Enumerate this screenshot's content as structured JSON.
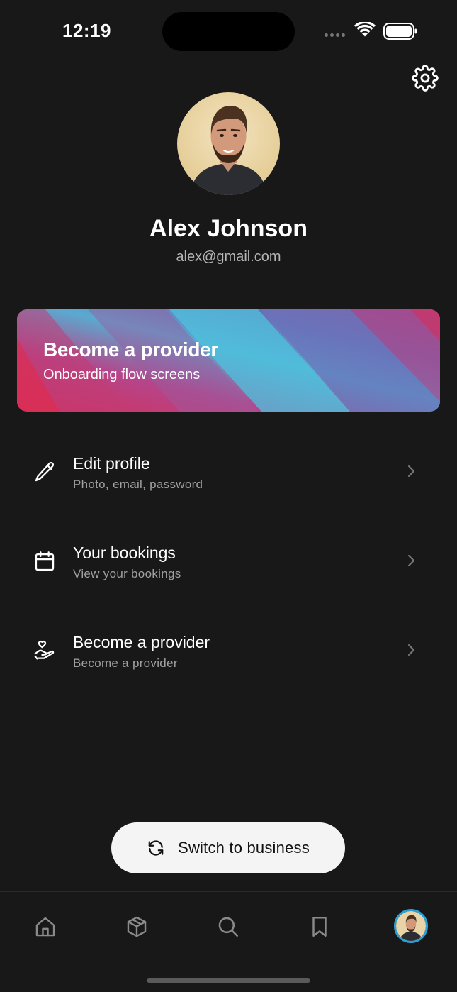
{
  "status_bar": {
    "time": "12:19"
  },
  "profile": {
    "name": "Alex Johnson",
    "email": "alex@gmail.com"
  },
  "banner": {
    "title": "Become a provider",
    "subtitle": "Onboarding flow screens",
    "colors": [
      "#d42f5a",
      "#b5458a",
      "#4fb8d6",
      "#6b6fb6",
      "#a04a8e"
    ]
  },
  "menu": [
    {
      "title": "Edit profile",
      "subtitle": "Photo, email, password",
      "icon": "pencil-icon"
    },
    {
      "title": "Your bookings",
      "subtitle": "View your bookings",
      "icon": "calendar-icon"
    },
    {
      "title": "Become a provider",
      "subtitle": "Become a provider",
      "icon": "hand-heart-icon"
    }
  ],
  "switch_button": {
    "label": "Switch to business",
    "icon": "refresh-icon"
  },
  "tab_bar": {
    "tabs": [
      "home-icon",
      "box-icon",
      "search-icon",
      "bookmark-icon",
      "profile-avatar"
    ],
    "active_accent": "#2a9fd6"
  }
}
